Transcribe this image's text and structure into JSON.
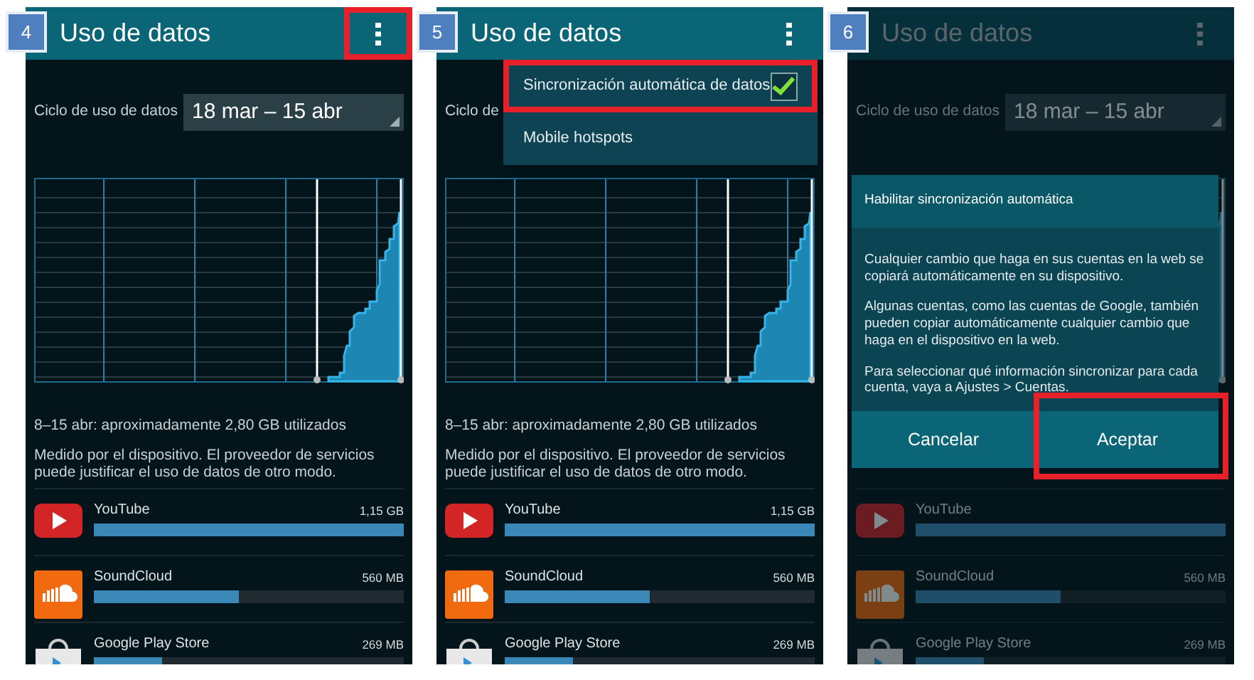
{
  "panels": [
    {
      "step": "4",
      "title": "Uso de datos",
      "menu_highlighted": true,
      "dimmed": false,
      "cycle_label": "Ciclo de uso de datos",
      "cycle_value": "18 mar – 15 abr",
      "summary": "8–15 abr: aproximadamente 2,80 GB utilizados",
      "note": "Medido por el dispositivo. El proveedor de servicios puede justificar el uso de datos de otro modo.",
      "apps": [
        {
          "kind": "youtube",
          "name": "YouTube",
          "size": "1,15 GB",
          "level": 1
        },
        {
          "kind": "soundcloud",
          "name": "SoundCloud",
          "size": "560 MB",
          "level": 0.47
        },
        {
          "kind": "playstore",
          "name": "Google Play Store",
          "size": "269 MB",
          "level": 0.22
        }
      ]
    },
    {
      "step": "5",
      "title": "Uso de datos",
      "menu_highlighted": false,
      "dimmed": false,
      "cycle_label": "Ciclo de",
      "summary": "8–15 abr: aproximadamente 2,80 GB utilizados",
      "note": "Medido por el dispositivo. El proveedor de servicios puede justificar el uso de datos de otro modo.",
      "menu": [
        {
          "kind": "checkbox",
          "label": "Sincronización automática de datos",
          "checked": true,
          "highlighted": true
        },
        {
          "kind": "plain",
          "label": "Mobile hotspots",
          "highlighted": false
        }
      ],
      "apps": [
        {
          "kind": "youtube",
          "name": "YouTube",
          "size": "1,15 GB",
          "level": 1
        },
        {
          "kind": "soundcloud",
          "name": "SoundCloud",
          "size": "560 MB",
          "level": 0.47
        },
        {
          "kind": "playstore",
          "name": "Google Play Store",
          "size": "269 MB",
          "level": 0.22
        }
      ]
    },
    {
      "step": "6",
      "title": "Uso de datos",
      "menu_highlighted": false,
      "dimmed": true,
      "cycle_label": "Ciclo de uso de datos",
      "cycle_value": "18 mar – 15 abr",
      "apps": [
        {
          "kind": "youtube",
          "name": "YouTube",
          "level": 1
        },
        {
          "kind": "soundcloud",
          "name": "SoundCloud",
          "size": "560 MB",
          "level": 0.47
        },
        {
          "kind": "playstore",
          "name": "Google Play Store",
          "size": "269 MB",
          "level": 0.22
        }
      ],
      "dialog": {
        "title": "Habilitar sincronización automática",
        "paragraphs": [
          "Cualquier cambio que haga en sus cuentas en la web se copiará automáticamente en su dispositivo.",
          "Algunas cuentas, como las cuentas de Google, también pueden copiar automáticamente cualquier cambio que haga en el dispositivo en la web.",
          "Para seleccionar qué información sincronizar para cada cuenta, vaya a Ajustes > Cuentas."
        ],
        "buttons": [
          {
            "label": "Cancelar",
            "highlighted": false
          },
          {
            "label": "Aceptar",
            "highlighted": true
          }
        ]
      }
    }
  ]
}
